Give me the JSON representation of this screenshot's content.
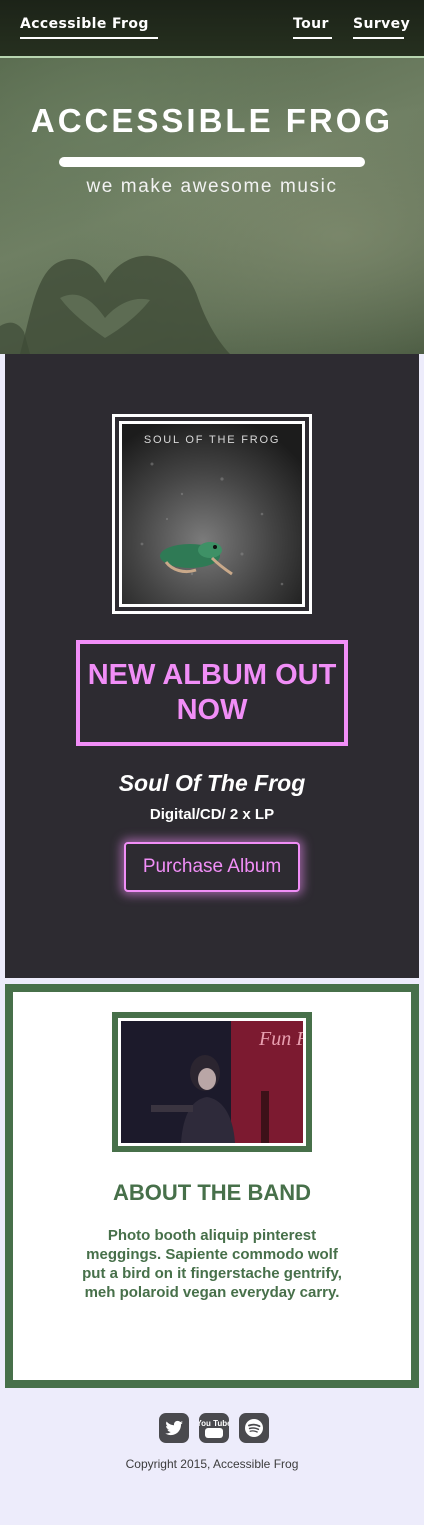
{
  "nav": {
    "brand": "Accessible Frog",
    "links": [
      "Tour",
      "Survey"
    ]
  },
  "hero": {
    "title": "ACCESSIBLE FROG",
    "tagline": "we make awesome music"
  },
  "album": {
    "cover_text": "SOUL OF THE FROG",
    "banner": "NEW ALBUM OUT NOW",
    "name": "Soul Of The Frog",
    "formats": "Digital/CD/ 2 x LP",
    "purchase_label": "Purchase Album"
  },
  "about": {
    "title": "ABOUT THE BAND",
    "text": "Photo booth aliquip pinterest meggings. Sapiente commodo wolf put a bird on it fingerstache gentrify, meh polaroid vegan everyday carry.",
    "photo_text": "Fun Fr"
  },
  "footer": {
    "social_icons": [
      "twitter-icon",
      "youtube-icon",
      "spotify-icon"
    ],
    "youtube_glyph": "You Tube",
    "copyright": "Copyright 2015, Accessible Frog"
  },
  "colors": {
    "accent": "#f18ef7",
    "green": "#47704a",
    "album_bg": "#2d2b31",
    "page_bg": "#edecfb"
  }
}
